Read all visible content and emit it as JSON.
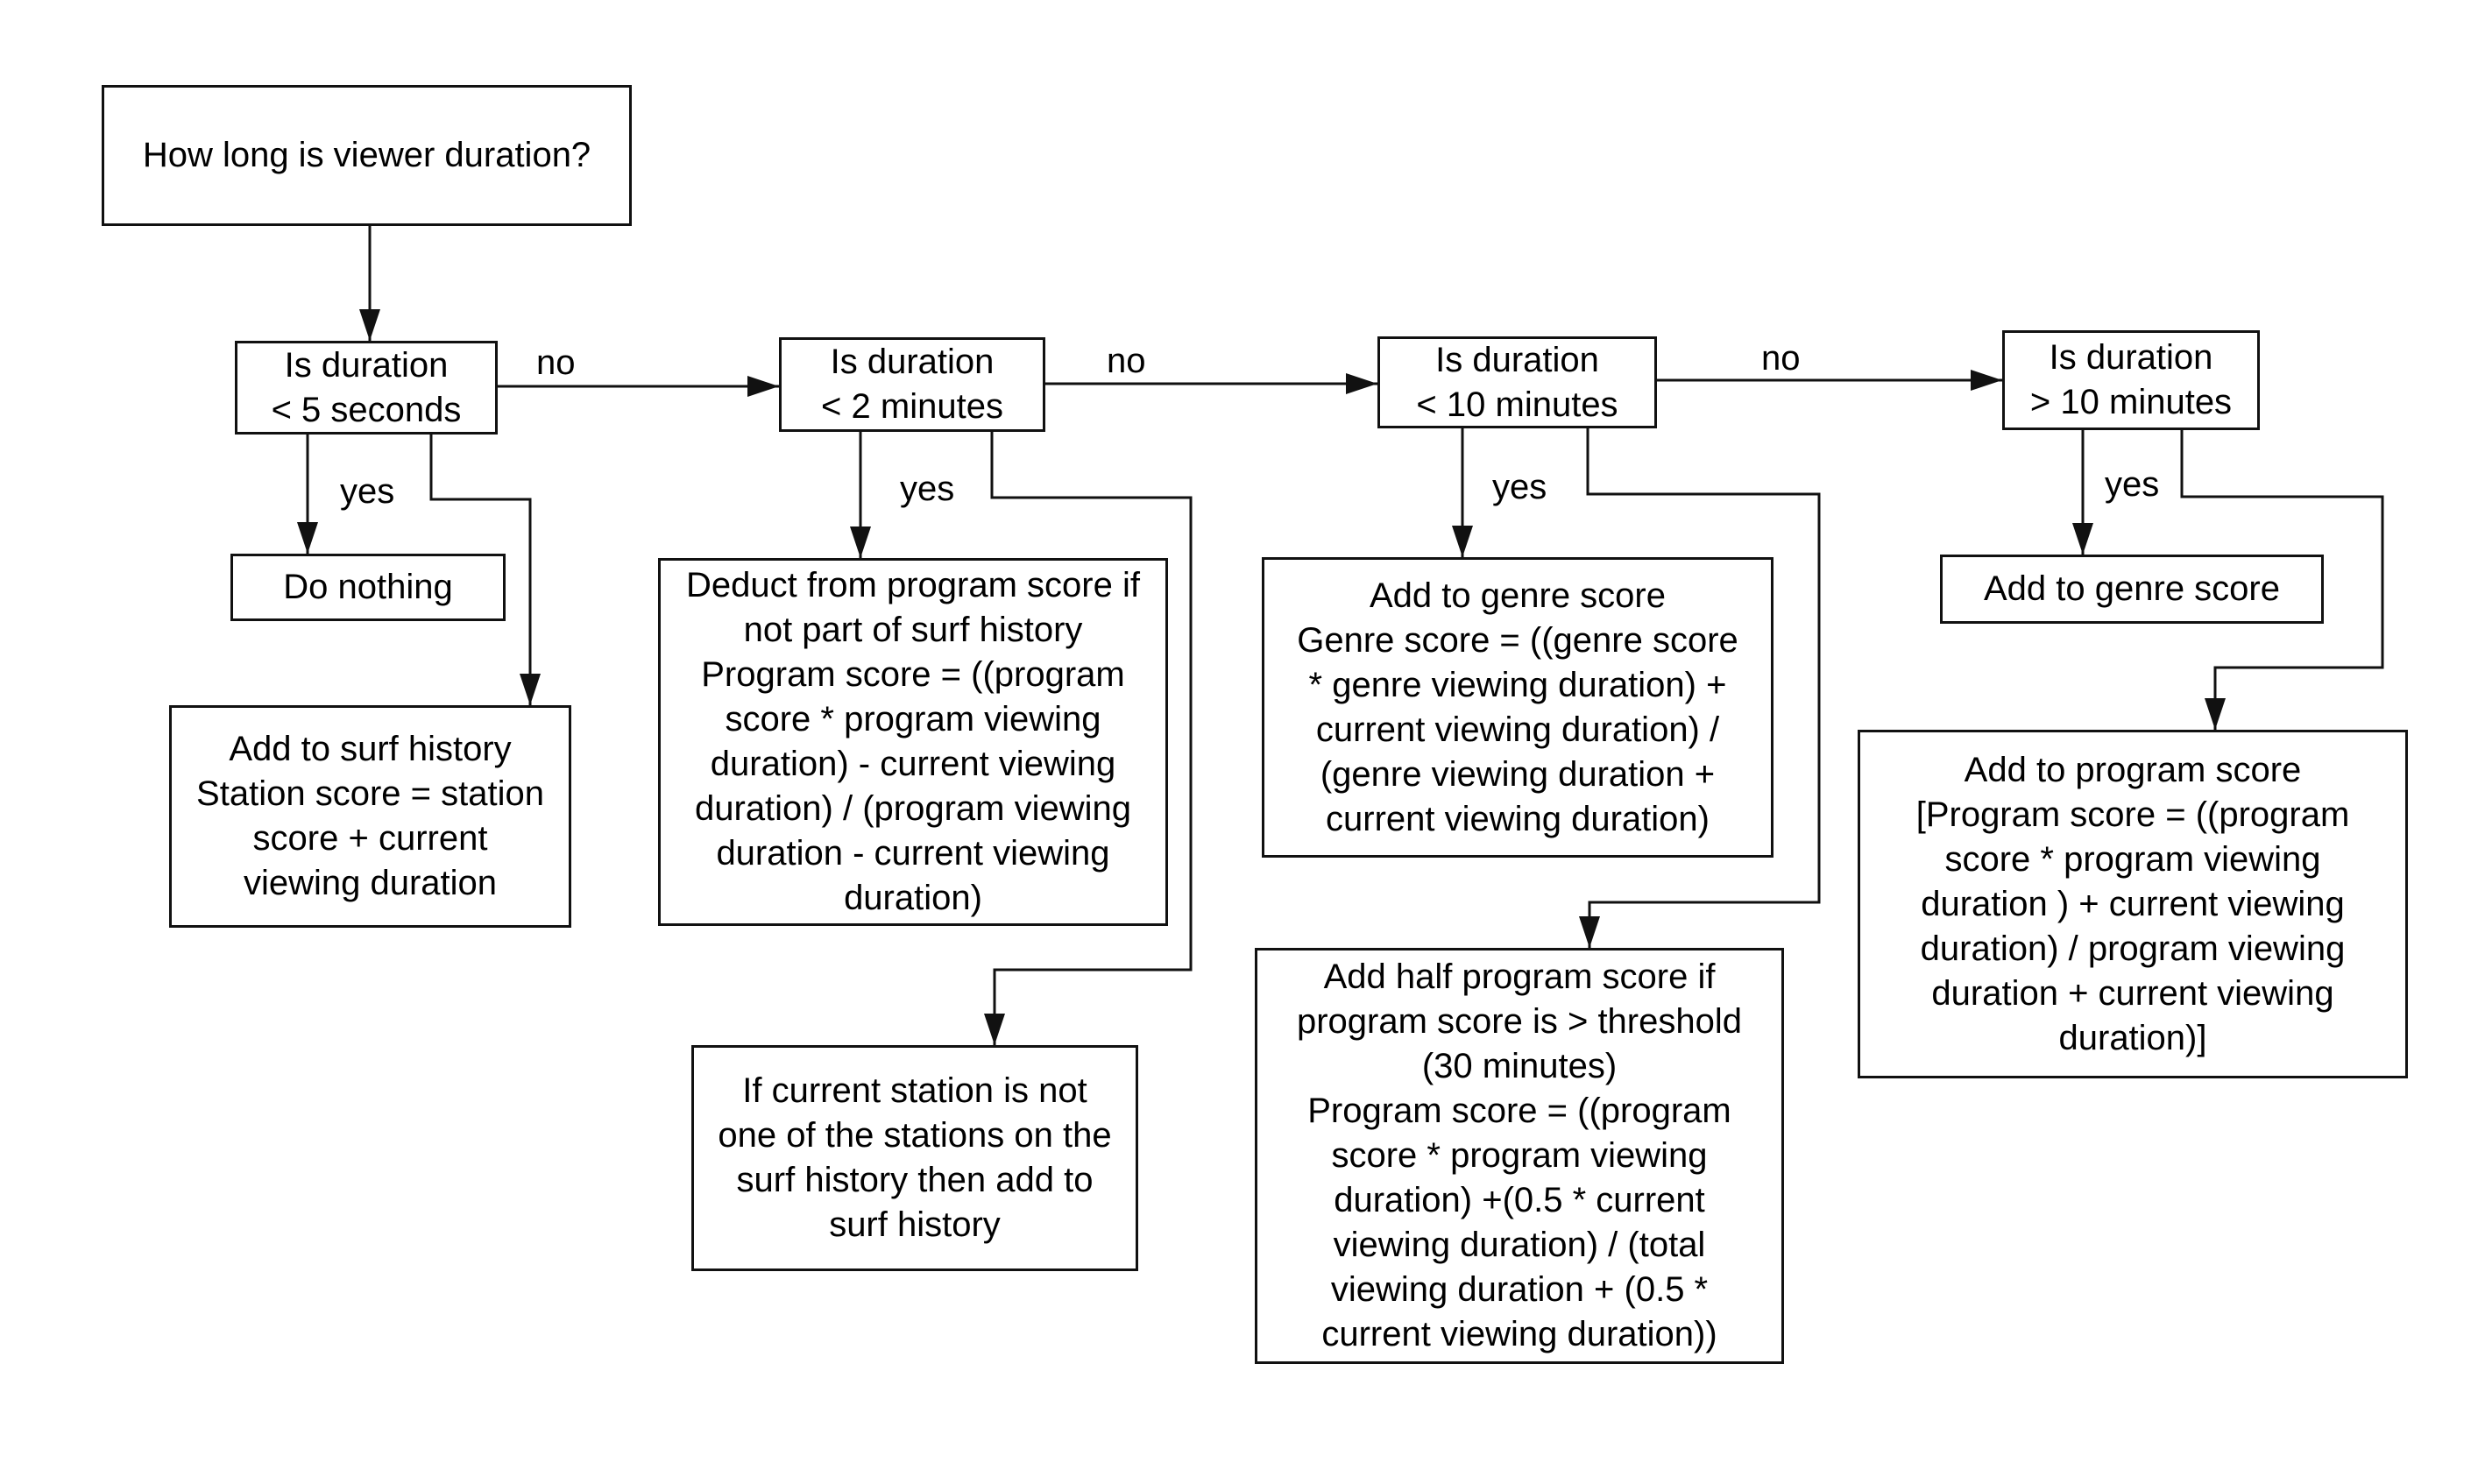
{
  "diagram": {
    "type": "flowchart",
    "start": {
      "lines": [
        "How long is viewer duration?"
      ]
    },
    "decisions": [
      {
        "id": "q1",
        "lines": [
          "Is duration",
          "< 5 seconds"
        ]
      },
      {
        "id": "q2",
        "lines": [
          "Is duration",
          "< 2 minutes"
        ]
      },
      {
        "id": "q3",
        "lines": [
          "Is duration",
          "< 10 minutes"
        ]
      },
      {
        "id": "q4",
        "lines": [
          "Is duration",
          "> 10 minutes"
        ]
      }
    ],
    "actions": {
      "do_nothing": {
        "lines": [
          "Do nothing"
        ]
      },
      "surf_history_station": {
        "lines": [
          "Add to surf history",
          "Station score = station",
          "score + current",
          "viewing duration"
        ]
      },
      "deduct_program": {
        "lines": [
          "Deduct from program score if",
          "not part of surf history",
          "Program score = ((program",
          "score * program viewing",
          "duration) - current viewing",
          "duration) / (program viewing",
          "duration - current viewing",
          "duration)"
        ]
      },
      "surf_history_check": {
        "lines": [
          "If current station is not",
          "one of the stations on the",
          "surf history then add to",
          "surf history"
        ]
      },
      "genre_score_formula": {
        "lines": [
          "Add to genre score",
          "Genre score = ((genre score",
          "* genre viewing duration) +",
          "current viewing duration) /",
          "(genre viewing duration +",
          "current viewing duration)"
        ]
      },
      "half_program": {
        "lines": [
          "Add half program score if",
          "program score is > threshold",
          "(30 minutes)",
          "Program score = ((program",
          "score * program viewing",
          "duration) +(0.5 * current",
          "viewing duration) / (total",
          "viewing duration + (0.5 *",
          "current viewing duration))"
        ]
      },
      "genre_score": {
        "lines": [
          "Add to genre score"
        ]
      },
      "program_score": {
        "lines": [
          "Add to program score",
          "[Program score = ((program",
          "score * program viewing",
          "duration ) + current viewing",
          "duration) / program viewing",
          "duration + current viewing",
          "duration)]"
        ]
      }
    },
    "edge_labels": {
      "no": "no",
      "yes": "yes"
    },
    "colors": {
      "stroke": "#111111",
      "background": "#ffffff",
      "text": "#000000"
    }
  }
}
